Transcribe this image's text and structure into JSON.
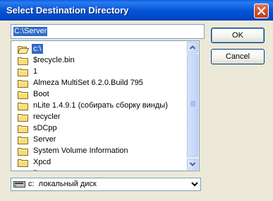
{
  "window": {
    "title": "Select Destination Directory"
  },
  "path_input": {
    "value": "C:\\Server"
  },
  "folder_list": {
    "items": [
      {
        "label": "c:\\",
        "icon": "open-folder-icon",
        "selected": true
      },
      {
        "label": "$recycle.bin",
        "icon": "folder-icon"
      },
      {
        "label": "1",
        "icon": "folder-icon"
      },
      {
        "label": "Almeza MultiSet 6.2.0.Build 795",
        "icon": "folder-icon"
      },
      {
        "label": "Boot",
        "icon": "folder-icon"
      },
      {
        "label": "nLite 1.4.9.1 (собирать сборку винды)",
        "icon": "folder-icon"
      },
      {
        "label": "recycler",
        "icon": "folder-icon"
      },
      {
        "label": "sDCpp",
        "icon": "folder-icon"
      },
      {
        "label": "Server",
        "icon": "folder-icon"
      },
      {
        "label": "System Volume Information",
        "icon": "folder-icon"
      },
      {
        "label": "Xpcd",
        "icon": "folder-icon"
      },
      {
        "label": "Вывод",
        "icon": "folder-icon"
      }
    ]
  },
  "drive_select": {
    "value": "c:  локальный диск",
    "icon": "drive-icon"
  },
  "buttons": {
    "ok": "OK",
    "cancel": "Cancel"
  },
  "colors": {
    "titlebar": "#0655d8",
    "selection": "#316ac5",
    "dialog_bg": "#ece9d8",
    "close_button": "#d2502c"
  }
}
